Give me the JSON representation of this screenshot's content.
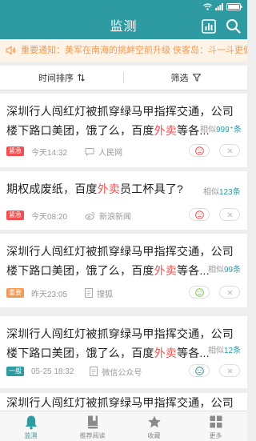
{
  "header": {
    "title": "监测"
  },
  "notice": {
    "text": "重要通知：美军在南海的挑衅空前升级 侠客岛：斗一斗更健"
  },
  "filters": {
    "sort_label": "时间排序",
    "filter_label": "筛选"
  },
  "items": [
    {
      "title_before": "深圳行人闯红灯被抓穿绿马甲指挥交通，公司楼下路口美团，饿了么，百度",
      "keyword": "外卖",
      "title_after": "等各...",
      "similar_prefix": "相似",
      "similar_count": "999⁺",
      "similar_suffix": "条",
      "badge": "紧急",
      "badge_color": "#f25050",
      "time": "今天14:32",
      "source": "人民网",
      "source_icon": "chat-icon",
      "sentiment": "negative",
      "sentiment_color": "#f25050"
    },
    {
      "title_before": "期权成废纸，百度",
      "keyword": "外卖",
      "title_after": "员工杯具了?",
      "similar_prefix": "相似",
      "similar_count": "123",
      "similar_suffix": "条",
      "badge": "紧急",
      "badge_color": "#f25050",
      "time": "今天08:20",
      "source": "新浪新闻",
      "source_icon": "weibo-icon",
      "sentiment": "negative",
      "sentiment_color": "#f25050"
    },
    {
      "title_before": "深圳行人闯红灯被抓穿绿马甲指挥交通，公司楼下路口美团，饿了么，百度",
      "keyword": "外卖",
      "title_after": "等各...",
      "similar_prefix": "相似",
      "similar_count": "99",
      "similar_suffix": "条",
      "badge": "重要",
      "badge_color": "#f39a55",
      "time": "昨天23:05",
      "source": "搜狐",
      "source_icon": "document-icon",
      "sentiment": "positive",
      "sentiment_color": "#7ac943"
    },
    {
      "title_before": "深圳行人闯红灯被抓穿绿马甲指挥交通，公司楼下路口美团，饿了么，百度",
      "keyword": "外卖",
      "title_after": "等各...",
      "similar_prefix": "相似",
      "similar_count": "12",
      "similar_suffix": "条",
      "badge": "一般",
      "badge_color": "#2e9aa2",
      "time": "05-25 18:32",
      "source": "微信公众号",
      "source_icon": "document-icon",
      "sentiment": "neutral",
      "sentiment_color": "#2e9aa2"
    },
    {
      "title_before": "深圳行人闯红灯被抓穿绿马甲指挥交通，公司楼"
    }
  ],
  "tabs": [
    {
      "label": "监测",
      "icon": "bell-icon",
      "active": true
    },
    {
      "label": "推荐阅读",
      "icon": "book-icon",
      "active": false
    },
    {
      "label": "收藏",
      "icon": "star-icon",
      "active": false
    },
    {
      "label": "更多",
      "icon": "grid-icon",
      "active": false
    }
  ],
  "colors": {
    "primary": "#2e9aa2",
    "keyword": "#f25050",
    "notice_text": "#f39a55",
    "notice_bg": "#fdf3e7"
  }
}
